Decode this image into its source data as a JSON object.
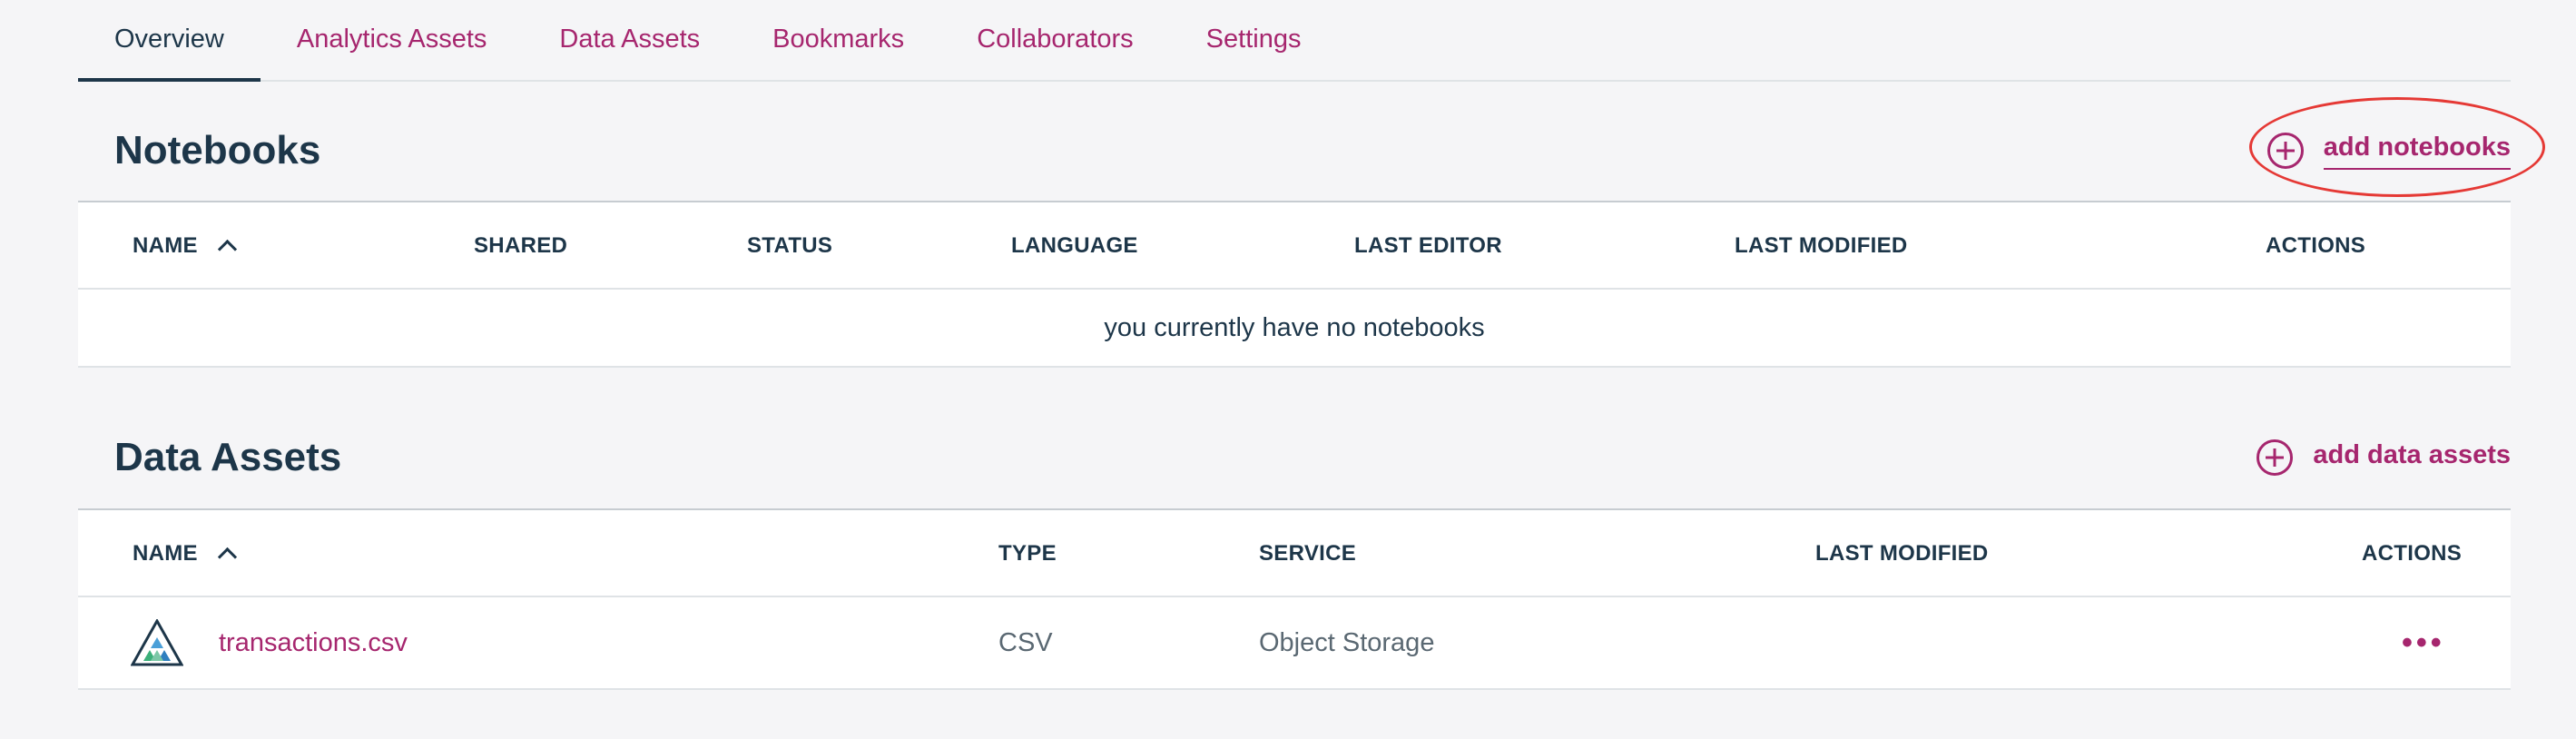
{
  "tabs": [
    {
      "label": "Overview",
      "active": true
    },
    {
      "label": "Analytics Assets"
    },
    {
      "label": "Data Assets"
    },
    {
      "label": "Bookmarks"
    },
    {
      "label": "Collaborators"
    },
    {
      "label": "Settings"
    }
  ],
  "notebooks": {
    "title": "Notebooks",
    "add_label": "add notebooks",
    "columns": [
      "NAME",
      "SHARED",
      "STATUS",
      "LANGUAGE",
      "LAST EDITOR",
      "LAST MODIFIED",
      "ACTIONS"
    ],
    "empty_message": "you currently have no notebooks"
  },
  "data_assets": {
    "title": "Data Assets",
    "add_label": "add data assets",
    "columns": [
      "NAME",
      "TYPE",
      "SERVICE",
      "LAST MODIFIED",
      "ACTIONS"
    ],
    "rows": [
      {
        "name": "transactions.csv",
        "type": "CSV",
        "service": "Object Storage",
        "last_modified": "",
        "actions": "•••"
      }
    ]
  },
  "colors": {
    "accent": "#a6266e",
    "text": "#1d3649",
    "annotation": "#e53935"
  },
  "icons": {
    "add": "plus-circle-icon",
    "sort": "chevron-up-icon",
    "file": "data-asset-triangle-icon",
    "actions": "overflow-menu-icon"
  }
}
